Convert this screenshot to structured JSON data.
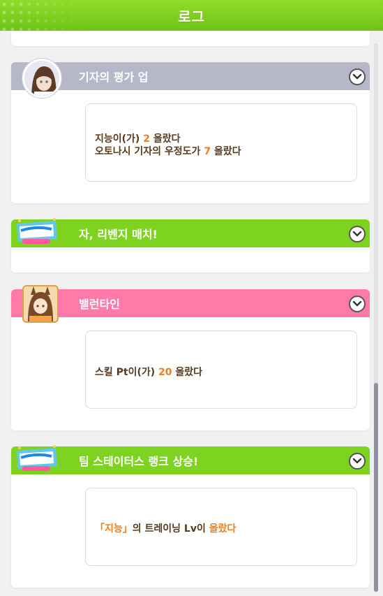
{
  "header": {
    "title": "로그"
  },
  "entries": [
    {
      "title": "기자의 평가 업",
      "color": "#b6b7c8",
      "icon": "reporter-portrait-icon",
      "lines": [
        {
          "a": "지능이(가) ",
          "b": "2",
          "c": " 올랐다"
        },
        {
          "a": "오토나시 기자의 우정도가 ",
          "b": "7",
          "c": " 올랐다"
        }
      ]
    },
    {
      "title": "자, 리벤지 매치!",
      "color": "#7ed321",
      "icon": "aoharu-cup-logo-icon"
    },
    {
      "title": "밸런타인",
      "color": "#ff7aa8",
      "icon": "horsegirl-portrait-icon",
      "lines": [
        {
          "a": "스킬 Pt이(가) ",
          "b": "20",
          "c": " 올랐다"
        }
      ]
    },
    {
      "title": "팀 스테이터스 랭크 상승!",
      "color": "#7ed321",
      "icon": "aoharu-cup-logo-icon",
      "lines": [
        {
          "a": "「지능」",
          "b": "의 트레이닝 Lv이 ",
          "c": "올랐다"
        }
      ]
    }
  ]
}
